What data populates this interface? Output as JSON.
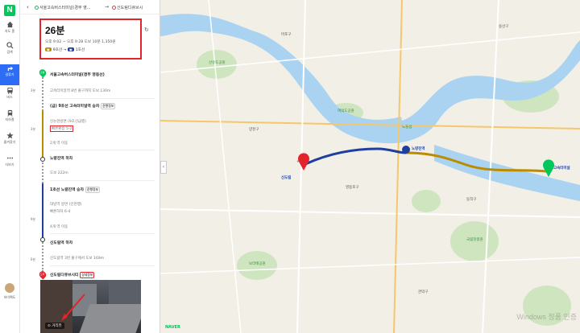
{
  "rail": {
    "logo": "N",
    "items": [
      {
        "label": "지도 홈",
        "icon": "home-icon"
      },
      {
        "label": "검색",
        "icon": "search-icon"
      },
      {
        "label": "길찾기",
        "icon": "directions-icon",
        "active": true
      },
      {
        "label": "버스",
        "icon": "bus-icon"
      },
      {
        "label": "지하철",
        "icon": "subway-icon"
      },
      {
        "label": "즐겨찾기",
        "icon": "star-icon"
      },
      {
        "label": "더보기",
        "icon": "more-icon"
      }
    ],
    "user_label": "하이펙도"
  },
  "route_header": {
    "from": "서울고속버스터미널(경부 영...",
    "to": "신도림디큐브시"
  },
  "summary": {
    "duration": "26분",
    "meta": "오후 9:02 ~ 오후 9:28   도보 10분   1,350원",
    "line1": "9호선",
    "line2": "1호선"
  },
  "steps": [
    {
      "text": "서울고속버스터미널(경부 영동선)",
      "kind": "bold"
    },
    {
      "text": "고속터미널역 8번 출구까지 도보 130m",
      "kind": "sub"
    },
    {
      "text": "(급) 9호선 고속터미널역 승차",
      "tag": "운행정보",
      "kind": "bold"
    },
    {
      "text": "신논현방면 (9호선급행)",
      "kind": "sub"
    },
    {
      "text": "빠른환승 5-2",
      "kind": "sub",
      "boxed": true
    },
    {
      "text": "2개 역 이동",
      "kind": "sub"
    },
    {
      "text": "노량진역 하차",
      "kind": "bold"
    },
    {
      "text": "도보 222m",
      "kind": "sub"
    },
    {
      "text": "1호선 노량진역 승차",
      "tag": "운행정보",
      "kind": "bold"
    },
    {
      "text": "대방역 방면 (인천행)",
      "kind": "sub"
    },
    {
      "text": "빠른하차 6-4",
      "kind": "sub"
    },
    {
      "text": "4개 역 이동",
      "kind": "sub"
    },
    {
      "text": "신도림역 하차",
      "kind": "bold"
    },
    {
      "text": "신도림역 3번 출구에서 도보 169m",
      "kind": "sub"
    },
    {
      "text": "신도림디큐브시티",
      "tag": "상세정보",
      "kind": "bold"
    }
  ],
  "side_labels": [
    "3분",
    "3분",
    "9분",
    "6분"
  ],
  "street_view_label": "거리뷰",
  "map": {
    "labels": [
      {
        "text": "고속터미널",
        "kind": "station"
      },
      {
        "text": "노량진역",
        "kind": "station"
      },
      {
        "text": "신도림",
        "kind": "station"
      },
      {
        "text": "영등포구",
        "kind": "normal"
      },
      {
        "text": "양천구",
        "kind": "normal"
      },
      {
        "text": "마포구",
        "kind": "normal"
      },
      {
        "text": "용산구",
        "kind": "normal"
      },
      {
        "text": "동작구",
        "kind": "normal"
      },
      {
        "text": "관악구",
        "kind": "normal"
      },
      {
        "text": "여의도공원",
        "kind": "green"
      },
      {
        "text": "선유도공원",
        "kind": "green"
      },
      {
        "text": "노들섬",
        "kind": "green"
      },
      {
        "text": "국립현충원",
        "kind": "green"
      },
      {
        "text": "보라매공원",
        "kind": "green"
      }
    ],
    "start_marker": "도착",
    "end_marker": "출발",
    "watermark": "Windows 정품 인증"
  },
  "colors": {
    "line9": "#bb8c00",
    "line1": "#1f3fa0",
    "walk": "#999999",
    "accent": "#2d6df6",
    "highlight": "#e3242b"
  }
}
